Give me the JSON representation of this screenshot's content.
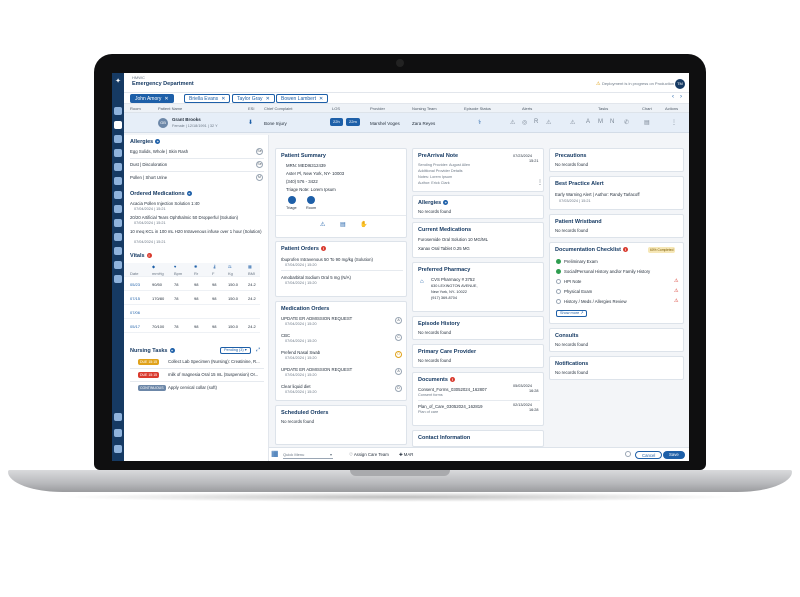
{
  "app": {
    "sub": "HMWC",
    "title": "Emergency Department",
    "deploy_notice": "Deployment is in progress on Production",
    "user_initials": "TM"
  },
  "tabs": [
    {
      "label": "John Amory"
    },
    {
      "label": "Briella Evans"
    },
    {
      "label": "Taylor Gray"
    },
    {
      "label": "Bowen Lambert"
    }
  ],
  "columns": [
    "Room",
    "Patient Name",
    "ESI",
    "Chief Complaint",
    "LOS",
    "Provider",
    "Nursing Team",
    "Episode Status",
    "Alerts",
    "Tasks",
    "Chart",
    "Actions"
  ],
  "patient": {
    "initials": "GB",
    "name": "Grant Brooks",
    "demo": "Female | 12/18/1991 | 32 Y",
    "complaint": "Bone Injury",
    "los_a": "22h",
    "los_b": "22m",
    "provider": "Marshel Voges",
    "nursing": "Zara Reyes"
  },
  "left": {
    "allergies_title": "Allergies",
    "allergies": [
      {
        "name": "Egg Solids, Whole | Skin Rash",
        "badge": "Se"
      },
      {
        "name": "Dust | Discoloration",
        "badge": "Se"
      },
      {
        "name": "Pollen | Short Urine",
        "badge": "M"
      }
    ],
    "meds_title": "Ordered Medications",
    "meds": [
      {
        "name": "Acacia Pollen Injection Solution 1:40",
        "date": "07/04/2024 | 15:21"
      },
      {
        "name": "20/20 Artificial Tears Ophthalmic 50 Dropperful (Solution)",
        "date": "07/04/2024 | 15:21"
      },
      {
        "name": "10 meq KCL in 100 mL H20 Intravenous infuse over 1 hour (Solution)",
        "date": "07/04/2024 | 15:21"
      }
    ],
    "vitals_title": "Vitals",
    "vitals_head": [
      "Date",
      "mmHg",
      "Bpm",
      "Rr",
      "F",
      "Kg",
      "BMI"
    ],
    "vitals": [
      [
        "05/23",
        "90/50",
        "78",
        "98",
        "98",
        "150.0",
        "24.2"
      ],
      [
        "07/15",
        "170/80",
        "78",
        "98",
        "98",
        "150.0",
        "24.2"
      ],
      [
        "07/06",
        "",
        "",
        "",
        "",
        "",
        ""
      ],
      [
        "05/17",
        "70/100",
        "78",
        "98",
        "98",
        "150.0",
        "24.2"
      ]
    ],
    "tasks_title": "Nursing Tasks",
    "tasks_filter": "Pending (3)",
    "tasks": [
      {
        "pill": "DUE 15:15",
        "pill_color": "#e0a21b",
        "text": "Collect Lab Specimen (Nursing): Creatinine, R..."
      },
      {
        "pill": "DUE 15:15",
        "pill_color": "#d93a2e",
        "text": "milk of magnesia Oral 15 mL (Suspension) Or..."
      },
      {
        "pill": "CONTINUOUS",
        "pill_color": "#6c87a8",
        "text": "Apply cervical collar (soft)"
      }
    ]
  },
  "summary": {
    "title": "Patient Summary",
    "mrn": "MRN: MEDI6312439",
    "address": "Aster Pl, New York, NY- 10003",
    "phone": "(340) 576 - 3422",
    "triage_note": "Triage Note: Lorem Ipsum",
    "triage": "Triage",
    "room": "Room"
  },
  "patient_orders": {
    "title": "Patient Orders",
    "items": [
      {
        "name": "Ibuprofen Intravenous 50 To 90 mg/kg (Solution)",
        "date": "07/04/2024 | 15:20"
      },
      {
        "name": "Amobarbital Sodium Oral 5 mg (N/A)",
        "date": "07/04/2024 | 15:20"
      }
    ]
  },
  "medication_orders": {
    "title": "Medication Orders",
    "items": [
      {
        "name": "UPDATE ER ADMISSION REQUEST",
        "date": "07/04/2024 | 15:20",
        "badge": "A"
      },
      {
        "name": "CBC",
        "date": "07/04/2024 | 15:20",
        "badge": "C"
      },
      {
        "name": "Prefend Nasal Swab",
        "date": "07/04/2024 | 15:20",
        "badge": "O"
      },
      {
        "name": "UPDATE ER ADMISSION REQUEST",
        "date": "07/04/2024 | 15:20",
        "badge": "A"
      },
      {
        "name": "Clear liquid diet",
        "date": "07/04/2024 | 15:20",
        "badge": "D"
      }
    ]
  },
  "scheduled": {
    "title": "Scheduled Orders",
    "empty": "No records found"
  },
  "prearrival": {
    "title": "PreArrival Note",
    "date": "07/23/2024",
    "time": "15:21",
    "lines": [
      "Sending Provider: August Allen",
      "Additional Provider Details",
      "Notes: Lorem Ipsum",
      "Author: Erick Clark"
    ]
  },
  "mid_allergies": {
    "title": "Allergies",
    "empty": "No records found"
  },
  "current_meds": {
    "title": "Current Medications",
    "items": [
      "Furosemide Oral Solution 10 MG/ML",
      "Xanax Oral Tablet 0.25 MG"
    ]
  },
  "pharmacy": {
    "title": "Preferred Pharmacy",
    "name": "CVS Pharmacy # 3752",
    "addr1": "630 LEXINGTON AVENUE,",
    "addr2": "New York, NY- 10022",
    "phone": "(917) 369-8704"
  },
  "episode": {
    "title": "Episode History",
    "empty": "No records found"
  },
  "pcp": {
    "title": "Primary Care Provider",
    "empty": "No records found"
  },
  "documents": {
    "title": "Documents",
    "items": [
      {
        "name": "Consent_Forms_03052024_162807",
        "type": "Consent forms",
        "date": "05/03/2024",
        "time": "16:28"
      },
      {
        "name": "Plan_of_Care_03052024_162819",
        "type": "Plan of care",
        "date": "02/13/2024",
        "time": "16:28"
      }
    ]
  },
  "contact": {
    "title": "Contact Information"
  },
  "precautions": {
    "title": "Precautions",
    "empty": "No records found"
  },
  "bpa": {
    "title": "Best Practice Alert",
    "name": "Early Warning Alert | Author: Randy Tarlacoff",
    "date": "07/03/2024 | 15:21"
  },
  "wristband": {
    "title": "Patient Wristband",
    "empty": "No records found"
  },
  "checklist": {
    "title": "Documentation Checklist",
    "badge": "60% Completed",
    "items": [
      "Preliminary Exam",
      "Social/Personal History and/or Family History",
      "HPI Note",
      "Physical Exam",
      "History / Meds / Allergies Review"
    ],
    "more": "Show more"
  },
  "consults": {
    "title": "Consults",
    "empty": "No records found"
  },
  "notifications": {
    "title": "Notifications",
    "empty": "No records found"
  },
  "footer": {
    "quick_menu": "Quick Menu",
    "assign": "Assign Care Team",
    "mar": "MAR",
    "cancel": "Cancel",
    "save": "Save"
  }
}
